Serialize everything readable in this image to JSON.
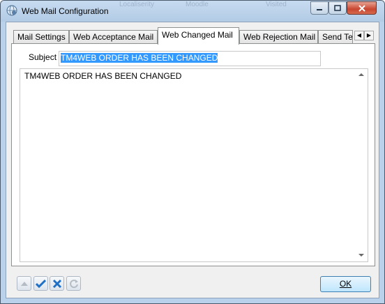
{
  "window": {
    "title": "Web Mail Configuration",
    "behind_titles": [
      "Localiserity",
      "Moodle",
      "Visited"
    ],
    "controls": [
      "minimize-icon",
      "maximize-icon",
      "close-icon"
    ]
  },
  "tabs": [
    {
      "label": "Mail Settings",
      "active": false
    },
    {
      "label": "Web Acceptance Mail",
      "active": false
    },
    {
      "label": "Web Changed Mail",
      "active": true
    },
    {
      "label": "Web Rejection Mail",
      "active": false
    },
    {
      "label": "Send Te",
      "active": false
    }
  ],
  "tab_scroll": {
    "left": "◀",
    "right": "▶"
  },
  "form": {
    "subject_label": "Subject",
    "subject_value": "TM4WEB ORDER HAS BEEN CHANGED",
    "body_text": "TM4WEB ORDER HAS BEEN CHANGED"
  },
  "footer": {
    "ok_label": "OK",
    "icons": [
      "up-arrow-icon",
      "check-icon",
      "cancel-x-icon",
      "refresh-icon"
    ]
  },
  "colors": {
    "accent": "#3399ff",
    "titlebar": "#c7dbf0",
    "check": "#1f6fc5"
  }
}
